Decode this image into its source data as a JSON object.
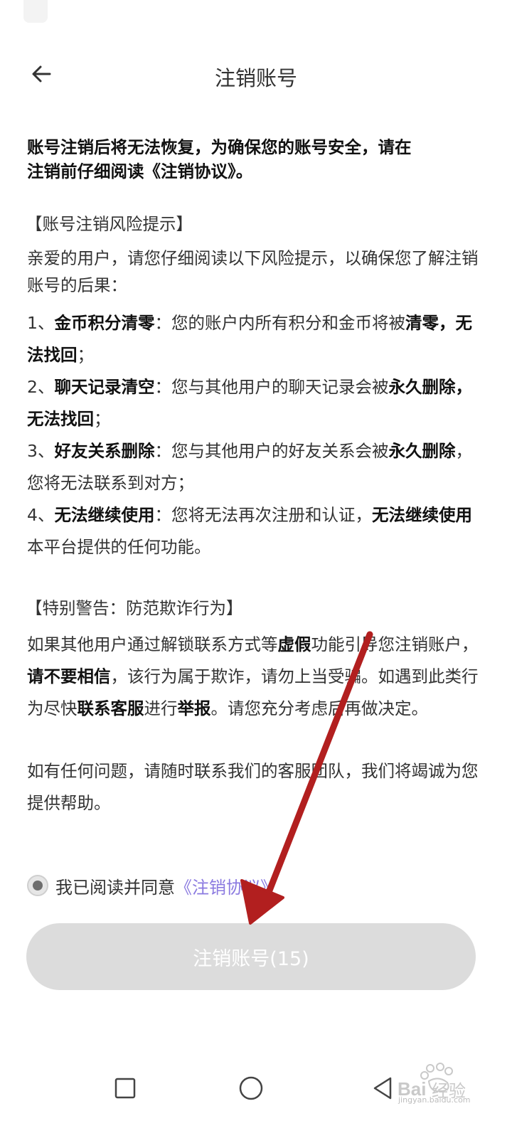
{
  "header": {
    "title": "注销账号"
  },
  "intro": {
    "line1": "账号注销后将无法恢复，为确保您的账号安全，请在",
    "line2": "注销前仔细阅读《注销协议》。"
  },
  "risk": {
    "section_title": "【账号注销风险提示】",
    "intro": "亲爱的用户，请您仔细阅读以下风险提示，以确保您了解注销账号的后果：",
    "items": [
      {
        "index": "1、",
        "title": "金币积分清零",
        "sep": "：",
        "text": "您的账户内所有积分和金币将被",
        "bold": "清零，无法找回",
        "tail": "；"
      },
      {
        "index": "2、",
        "title": "聊天记录清空",
        "sep": "：",
        "text": "您与其他用户的聊天记录会被",
        "bold": "永久删除，无法找回",
        "tail": "；"
      },
      {
        "index": "3、",
        "title": "好友关系删除",
        "sep": "：",
        "text": "您与其他用户的好友关系会被",
        "bold": "永久删除",
        "tail": "，您将无法联系到对方；"
      },
      {
        "index": "4、",
        "title": "无法继续使用",
        "sep": "：",
        "text": "您将无法再次注册和认证，",
        "bold": "无法继续使用",
        "tail": "本平台提供的任何功能。"
      }
    ]
  },
  "warning": {
    "section_title": "【特别警告：防范欺诈行为】",
    "p1_a": "如果其他用户通过解锁联系方式等",
    "p1_b": "虚假",
    "p1_c": "功能引导您注销账户，",
    "p1_d": "请不要相信",
    "p1_e": "，该行为属于欺诈，请勿上当受骗。如遇到此类行为尽快",
    "p1_f": "联系客服",
    "p1_g": "进行",
    "p1_h": "举报",
    "p1_i": "。请您充分考虑后再做决定。",
    "p2": "如有任何问题，请随时联系我们的客服团队，我们将竭诚为您提供帮助。"
  },
  "agreement": {
    "label": "我已阅读并同意",
    "link": "《注销协议》",
    "checked": true
  },
  "submit": {
    "label": "注销账号(15)"
  },
  "watermark": {
    "brand": "Bai",
    "brand2": "经验",
    "url": "jingyan.baidu.com"
  },
  "colors": {
    "link": "#8b7ae0",
    "button_disabled": "#dcdcdc",
    "arrow_annotation": "#b21f1f"
  }
}
